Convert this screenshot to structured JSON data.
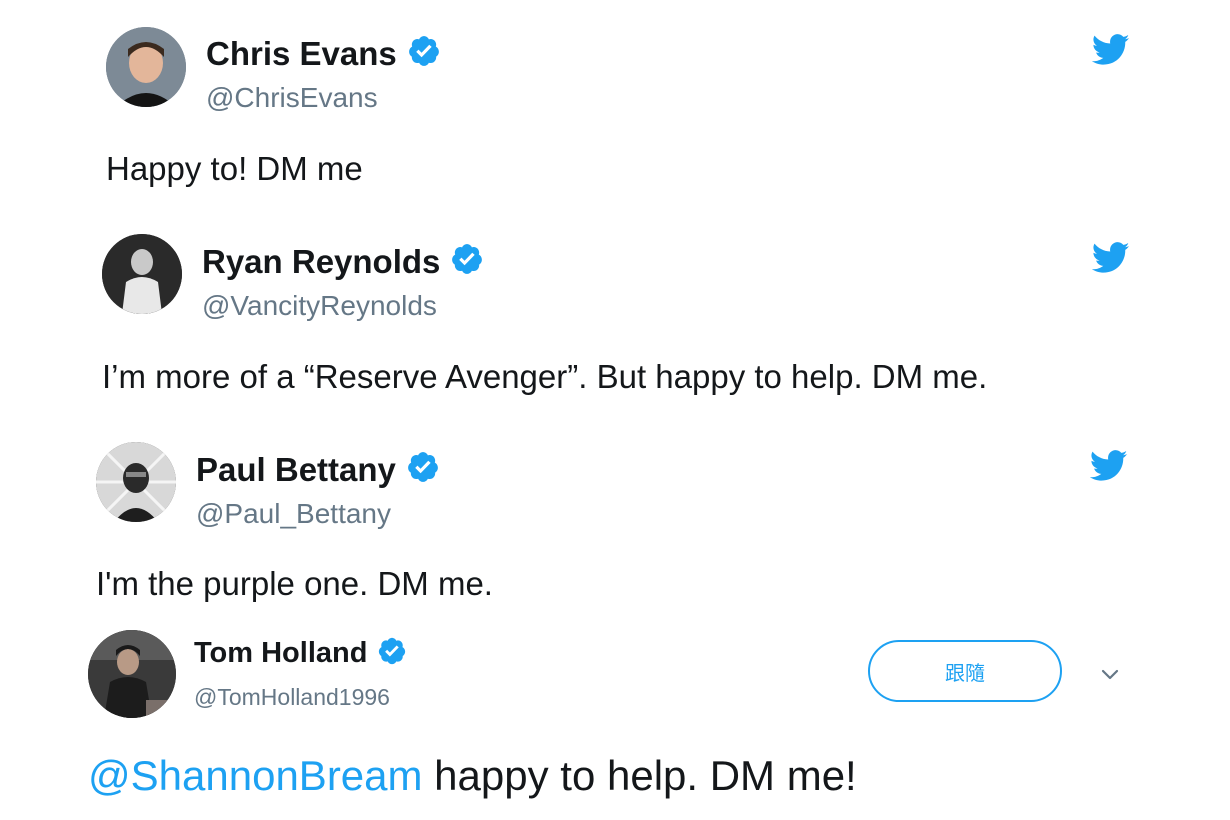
{
  "tweets": [
    {
      "name": "Chris Evans",
      "handle": "@ChrisEvans",
      "text": "Happy to! DM me",
      "verified": true,
      "avatar_icon": "avatar-photo"
    },
    {
      "name": "Ryan Reynolds",
      "handle": "@VancityReynolds",
      "text": "I’m more of a “Reserve Avenger”. But happy to help. DM me.",
      "verified": true,
      "avatar_icon": "avatar-photo"
    },
    {
      "name": "Paul Bettany",
      "handle": "@Paul_Bettany",
      "text": "I'm the purple one. DM me.",
      "verified": true,
      "avatar_icon": "avatar-photo"
    },
    {
      "name": "Tom Holland",
      "handle": "@TomHolland1996",
      "mention": "@ShannonBream",
      "text": " happy to help. DM me!",
      "verified": true,
      "follow_label": "跟隨",
      "avatar_icon": "avatar-photo"
    }
  ],
  "colors": {
    "twitter_blue": "#1da1f2",
    "text": "#14171a",
    "secondary": "#657786"
  },
  "icons": {
    "bird": "twitter-bird-icon",
    "verified": "verified-badge-icon",
    "more": "chevron-down-icon"
  }
}
